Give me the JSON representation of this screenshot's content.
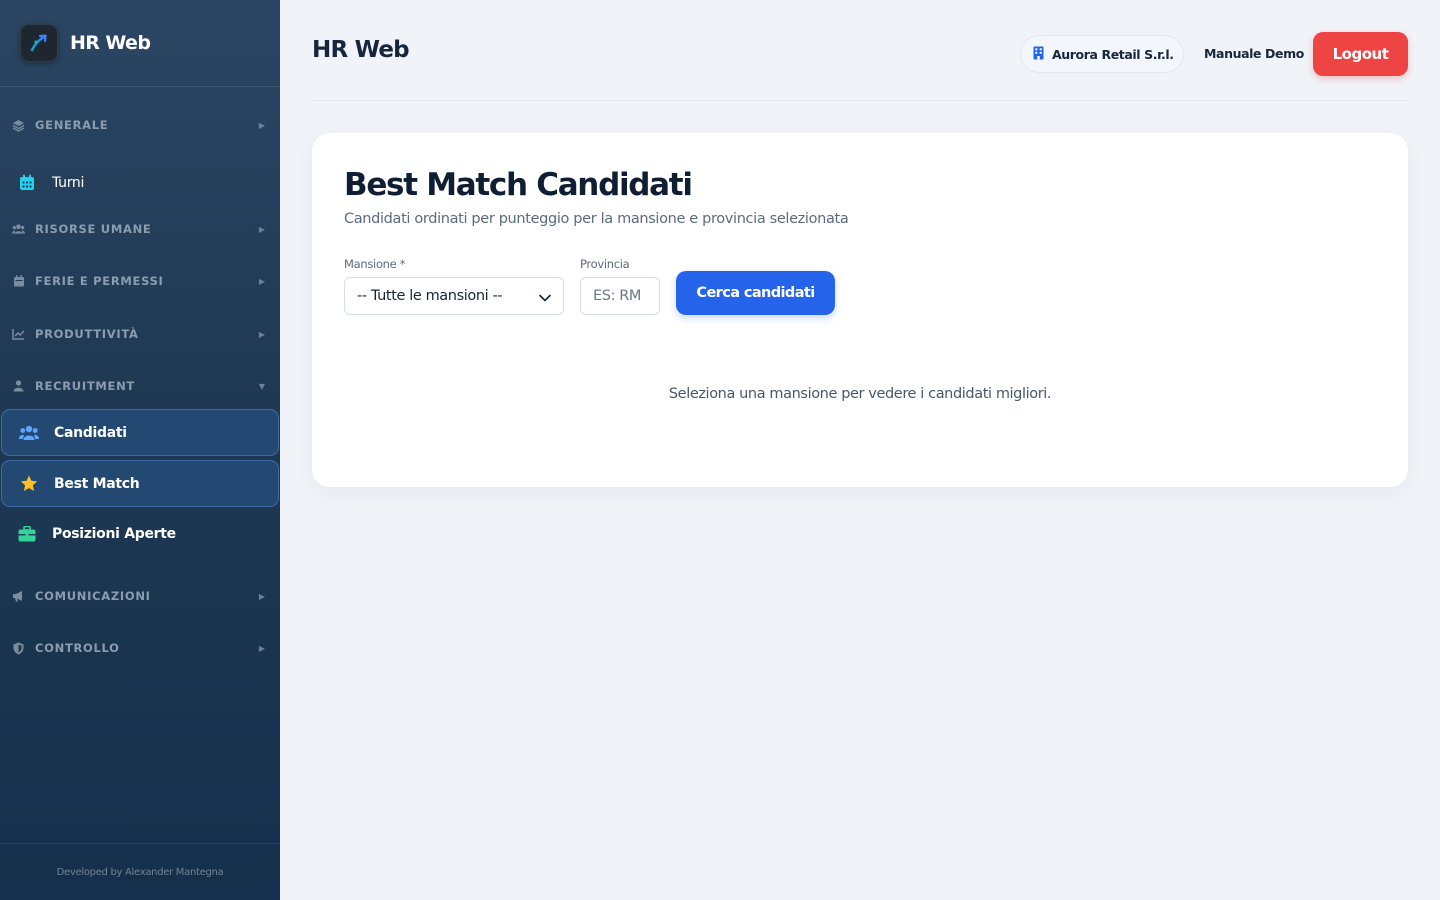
{
  "app": {
    "name": "HR Web",
    "footer": "Developed by Alexander Mantegna"
  },
  "sidebar": {
    "sections": [
      {
        "label": "GENERALE",
        "icon": "layers-icon",
        "expanded": false
      },
      {
        "label": "RISORSE UMANE",
        "icon": "users-icon",
        "expanded": false
      },
      {
        "label": "FERIE E PERMESSI",
        "icon": "calendar-icon",
        "expanded": false
      },
      {
        "label": "PRODUTTIVITÀ",
        "icon": "chart-line-icon",
        "expanded": false
      },
      {
        "label": "RECRUITMENT",
        "icon": "user-icon",
        "expanded": true
      },
      {
        "label": "COMUNICAZIONI",
        "icon": "megaphone-icon",
        "expanded": false
      },
      {
        "label": "CONTROLLO",
        "icon": "shield-icon",
        "expanded": false
      }
    ],
    "items": {
      "turni": {
        "label": "Turni",
        "icon": "calendar-icon",
        "active": false
      },
      "candidati": {
        "label": "Candidati",
        "icon": "users-icon",
        "active": true
      },
      "best_match": {
        "label": "Best Match",
        "icon": "star-icon",
        "active": true
      },
      "posizioni_aperte": {
        "label": "Posizioni Aperte",
        "icon": "briefcase-icon",
        "active": false
      }
    }
  },
  "header": {
    "title": "HR Web",
    "company": "Aurora Retail S.r.l.",
    "manual_link": "Manuale Demo",
    "logout_label": "Logout"
  },
  "main": {
    "title": "Best Match Candidati",
    "subtitle": "Candidati ordinati per punteggio per la mansione e provincia selezionata",
    "mansione": {
      "label": "Mansione *",
      "selected": "-- Tutte le mansioni --"
    },
    "provincia": {
      "label": "Provincia",
      "placeholder": "ES: RM",
      "value": ""
    },
    "search_button": "Cerca candidati",
    "empty_message": "Seleziona una mansione per vedere i candidati migliori."
  },
  "colors": {
    "sidebar_top": "#2b4663",
    "sidebar_bottom": "#15304c",
    "active_item_bg": "#234872",
    "primary": "#2563eb",
    "danger": "#ef4444",
    "page_bg": "#f0f4f9",
    "star": "#fbbf24",
    "briefcase": "#34d399",
    "users_icon": "#60a5fa",
    "calendar_icon": "#22d3ee"
  }
}
